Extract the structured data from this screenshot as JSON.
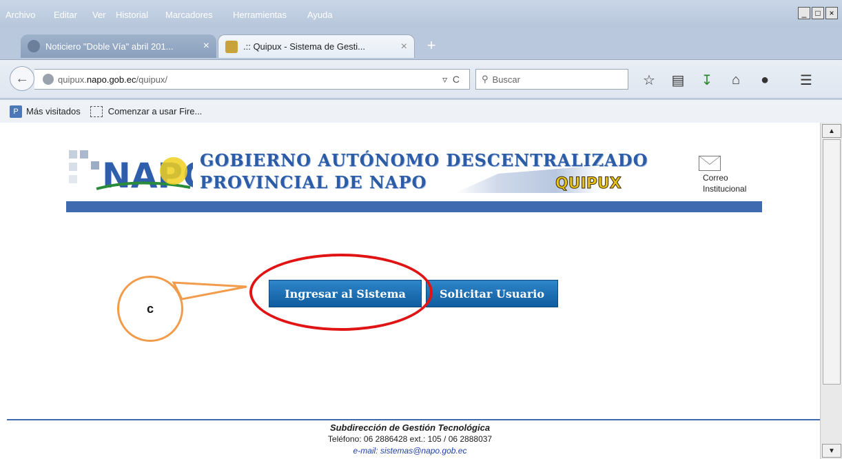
{
  "menu": [
    "Archivo",
    "Editar",
    "Ver",
    "Historial",
    "Marcadores",
    "Herramientas",
    "Ayuda"
  ],
  "window_controls": {
    "minimize": "_",
    "maximize": "□",
    "close": "×"
  },
  "tabs": [
    {
      "title": "Noticiero \"Doble Vía\" abril 201...",
      "close": "×"
    },
    {
      "title": ".:: Quipux - Sistema de Gesti...",
      "close": "×"
    }
  ],
  "new_tab": "+",
  "address": {
    "host": "quipux.",
    "domain": "napo.gob.ec",
    "path": "/quipux/",
    "dropdown": "▿",
    "reload": "C"
  },
  "search": {
    "placeholder": "Buscar"
  },
  "bookmarks": {
    "most_visited": "Más visitados",
    "getting_started": "Comenzar a usar Fire..."
  },
  "header": {
    "line1": "GOBIERNO AUTÓNOMO DESCENTRALIZADO",
    "line2": "PROVINCIAL DE NAPO",
    "logo_text": "NAPO",
    "brand": "QUIPUX",
    "mail_label_1": "Correo",
    "mail_label_2": "Institucional"
  },
  "buttons": {
    "login": "Ingresar al Sistema",
    "request_user": "Solicitar Usuario"
  },
  "annotation": {
    "label": "c",
    "color": "#e01414",
    "callout_color": "#f29b4b"
  },
  "footer": {
    "department": "Subdirección de Gestión Tecnológica",
    "phone": "Teléfono: 06 2886428 ext.: 105 /  06 2888037",
    "email": "e-mail: sistemas@napo.gob.ec"
  },
  "colors": {
    "accent": "#3f6ab0",
    "button": "#1a6fb3",
    "brand_yellow": "#e6c21b"
  }
}
